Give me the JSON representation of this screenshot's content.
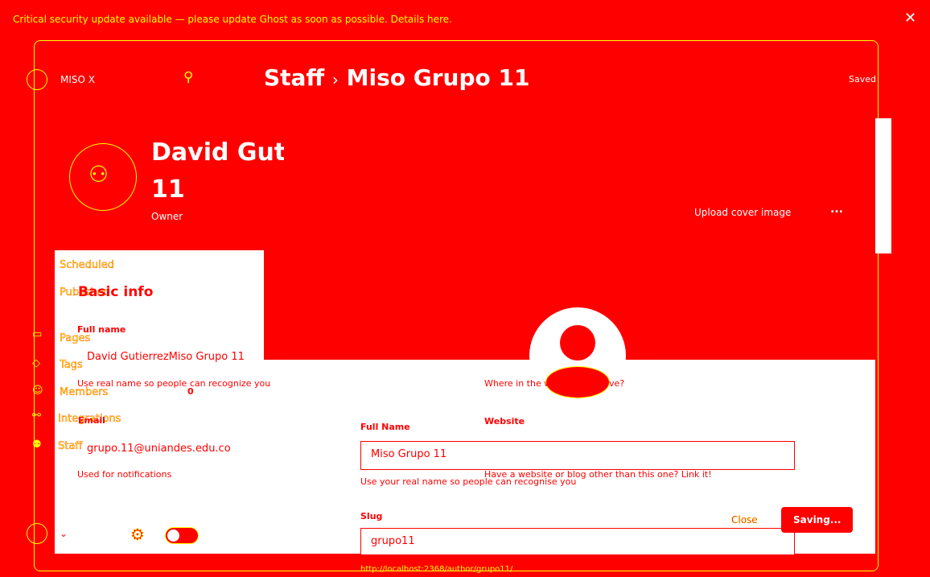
{
  "banner": {
    "text": "Critical security update available — please update Ghost as soon as possible. Details here."
  },
  "topbar": {
    "site_name": "MISO X",
    "breadcrumb_parent": "Staff",
    "breadcrumb_sep": "›",
    "breadcrumb_current": "Miso Grupo 11",
    "saved_label": "Saved"
  },
  "profile": {
    "name_line1": "David Gutierrez",
    "name_line2": "11",
    "role": "Owner",
    "upload_cover": "Upload cover image",
    "more": "..."
  },
  "sidebar": {
    "items": [
      {
        "label": "Scheduled"
      },
      {
        "label": "Published"
      },
      {
        "label": "Pages"
      },
      {
        "label": "Tags"
      },
      {
        "label": "Members"
      },
      {
        "label": "Integrations"
      },
      {
        "label": "Staff"
      }
    ],
    "members_count": "0"
  },
  "basic_info": {
    "title": "Basic info",
    "full_name_label": "Full name",
    "full_name_value": "David GutierrezMiso Grupo 11",
    "full_name_help": "Use real name so people can recognize you",
    "email_label": "Email",
    "email_value": "grupo.11@uniandes.edu.co",
    "email_help": "Used for notifications"
  },
  "form": {
    "location_help": "Where in the world do you live?",
    "website_label": "Website",
    "website_help": "Have a website or blog other than this one? Link it!",
    "full_name_label": "Full Name",
    "full_name_value": "Miso Grupo 11",
    "full_name_help": "Use your real name so people can recognise you",
    "slug_label": "Slug",
    "slug_value": "grupo11",
    "slug_url": "http://localhost:2368/author/grupo11/",
    "close_label": "Close",
    "saving_label": "Saving..."
  },
  "colors": {
    "background": "#ff0000",
    "outline": "#ffff00",
    "panel": "#ffffff"
  }
}
